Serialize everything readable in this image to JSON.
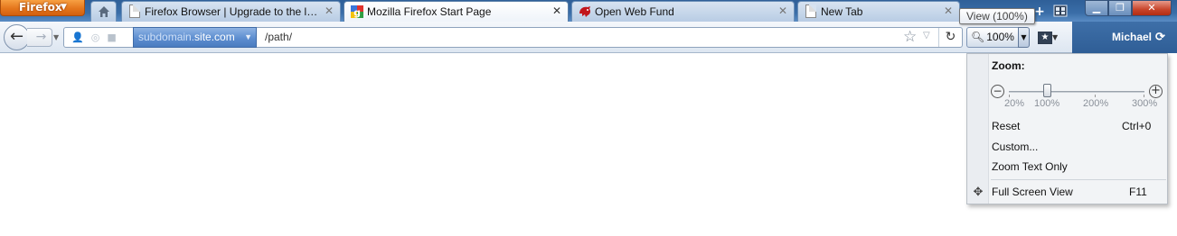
{
  "browser": {
    "app_button_label": "Firefox",
    "tooltip": "View (100%)"
  },
  "tabs": [
    {
      "title": "Firefox Browser | Upgrade to the late...",
      "selected": false,
      "favicon": "page-icon"
    },
    {
      "title": "Mozilla Firefox Start Page",
      "selected": true,
      "favicon": "google-icon"
    },
    {
      "title": "Open Web Fund",
      "selected": false,
      "favicon": "red-dragon-icon"
    },
    {
      "title": "New Tab",
      "selected": false,
      "favicon": "page-icon"
    }
  ],
  "urlbar": {
    "subdomain": "subdomain.",
    "domain": "site.com",
    "path": "/path/"
  },
  "zoom": {
    "level_label": "100%"
  },
  "account": {
    "name": "Michael"
  },
  "zoom_menu": {
    "heading": "Zoom:",
    "current_level_percent": 100,
    "scale_labels": [
      "20%",
      "100%",
      "200%",
      "300%"
    ],
    "items": [
      {
        "label": "Reset",
        "shortcut": "Ctrl+0"
      },
      {
        "label": "Custom...",
        "shortcut": ""
      },
      {
        "label": "Zoom Text Only",
        "shortcut": ""
      },
      {
        "label": "Full Screen View",
        "shortcut": "F11"
      }
    ]
  },
  "colors": {
    "titlebar": "#3a6ea8",
    "firefox_button": "#e4761c",
    "domain_highlight": "#5d8ed0",
    "window_close": "#c7442a"
  }
}
